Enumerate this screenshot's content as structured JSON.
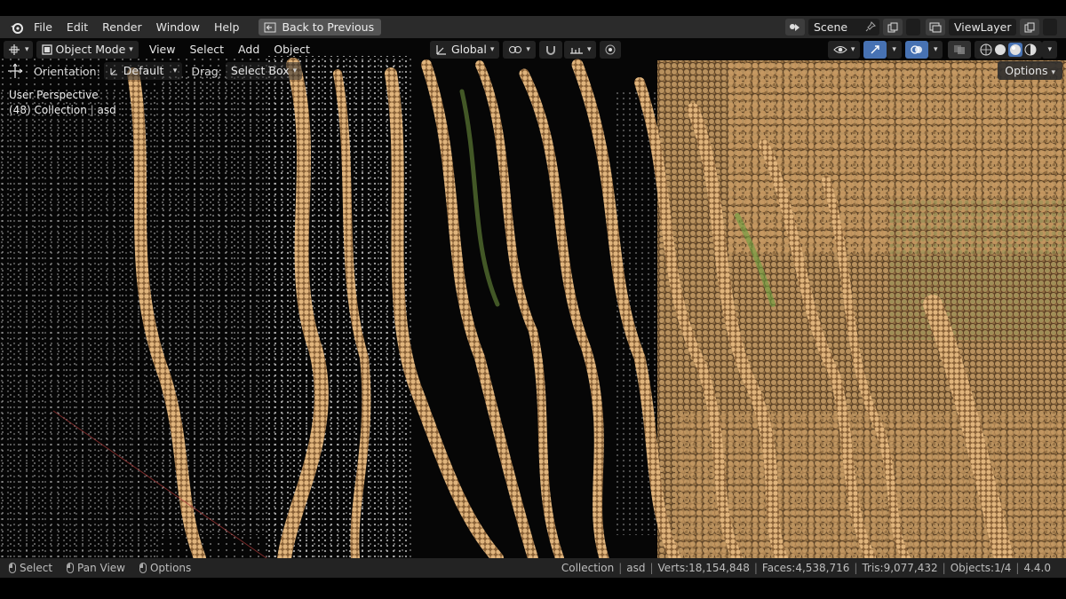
{
  "menubar": {
    "items": [
      "File",
      "Edit",
      "Render",
      "Window",
      "Help"
    ],
    "back_button": "Back to Previous",
    "scene_name": "Scene",
    "view_layer": "ViewLayer"
  },
  "viewport_header": {
    "mode": "Object Mode",
    "menus": [
      "View",
      "Select",
      "Add",
      "Object"
    ],
    "transform_orientation": "Global"
  },
  "tool_settings": {
    "orientation_label": "Orientation:",
    "orientation_value": "Default",
    "drag_label": "Drag:",
    "drag_value": "Select Box",
    "options": "Options"
  },
  "overlay": {
    "perspective": "User Perspective",
    "collection": "(48) Collection",
    "active_object": "asd"
  },
  "statusbar": {
    "hints": [
      {
        "label": "Select"
      },
      {
        "label": "Pan View"
      },
      {
        "label": "Options"
      }
    ],
    "collection": "Collection",
    "object": "asd",
    "verts": "Verts:18,154,848",
    "faces": "Faces:4,538,716",
    "tris": "Tris:9,077,432",
    "objects": "Objects:1/4",
    "version": "4.4.0"
  },
  "colors": {
    "accent_blue": "#4772b3",
    "bar_bg": "#2b2b2b",
    "status_bg": "#232323",
    "root_tan": "#c79a63",
    "points_white": "#e8e8e8"
  }
}
